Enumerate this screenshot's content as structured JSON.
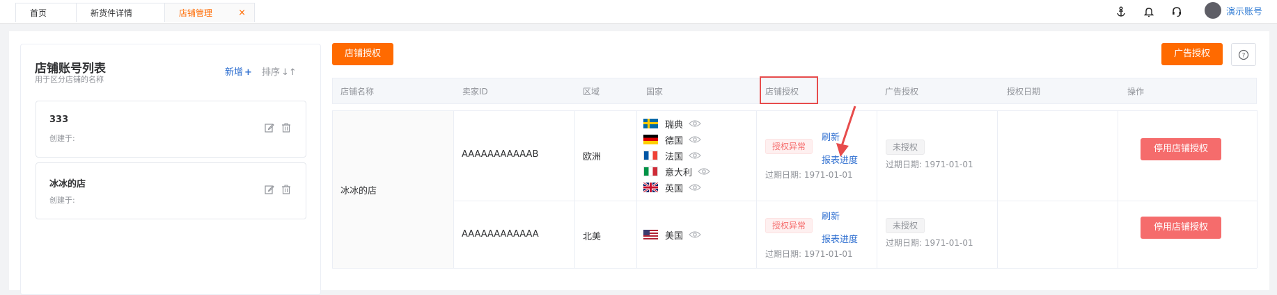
{
  "tabs": [
    {
      "label": "首页"
    },
    {
      "label": "新货件详情"
    },
    {
      "label": "店铺管理",
      "close": "×"
    }
  ],
  "user": {
    "name": "演示账号"
  },
  "left": {
    "title": "店铺账号列表",
    "subtitle": "用于区分店铺的名称",
    "add_label": "新增",
    "sort_label": "排序",
    "stores": [
      {
        "name": "333",
        "created": "创建于:"
      },
      {
        "name": "冰冰的店",
        "created": "创建于:"
      }
    ]
  },
  "toolbar": {
    "store_auth": "店铺授权",
    "ad_auth": "广告授权",
    "help": "?"
  },
  "table": {
    "headers": [
      "店铺名称",
      "卖家ID",
      "区域",
      "国家",
      "店铺授权",
      "广告授权",
      "授权日期",
      "操作"
    ],
    "store_name": "冰冰的店",
    "rows": [
      {
        "seller_id": "AAAAAAAAAAAB",
        "region": "欧洲",
        "countries": [
          {
            "name": "瑞典",
            "flag": "se"
          },
          {
            "name": "德国",
            "flag": "de"
          },
          {
            "name": "法国",
            "flag": "fr"
          },
          {
            "name": "意大利",
            "flag": "it"
          },
          {
            "name": "英国",
            "flag": "gb"
          }
        ],
        "store_auth_tag": "授权异常",
        "refresh": "刷新",
        "report_progress": "报表进度",
        "store_expiry": "过期日期: 1971-01-01",
        "ad_auth_tag": "未授权",
        "ad_expiry": "过期日期: 1971-01-01",
        "action": "停用店铺授权"
      },
      {
        "seller_id": "AAAAAAAAAAAA",
        "region": "北美",
        "countries": [
          {
            "name": "美国",
            "flag": "us"
          }
        ],
        "store_auth_tag": "授权异常",
        "refresh": "刷新",
        "report_progress": "报表进度",
        "store_expiry": "过期日期: 1971-01-01",
        "ad_auth_tag": "未授权",
        "ad_expiry": "过期日期: 1971-01-01",
        "action": "停用店铺授权"
      }
    ]
  },
  "colors": {
    "accent": "#ff6a00",
    "link": "#2f6fd0",
    "danger": "#f56c6c",
    "highlight": "#e74c4c"
  }
}
